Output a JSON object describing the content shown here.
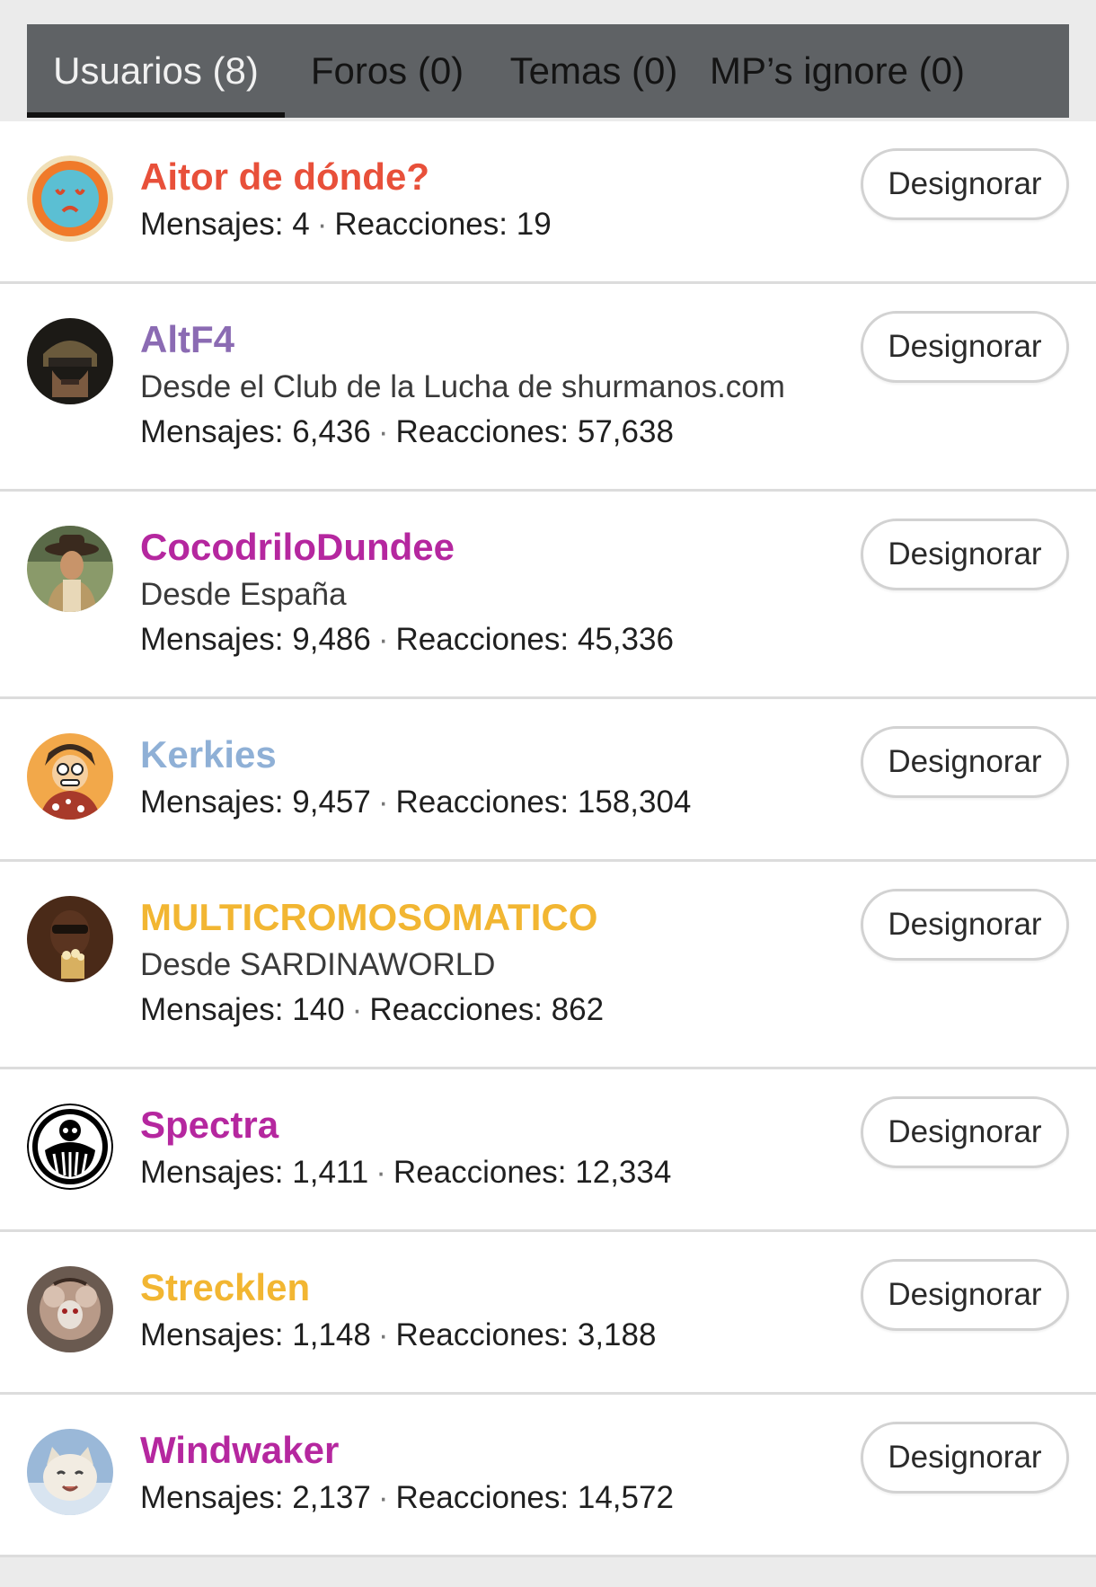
{
  "tabs": [
    {
      "label": "Usuarios (8)",
      "active": true
    },
    {
      "label": "Foros (0)",
      "active": false
    },
    {
      "label": "Temas (0)",
      "active": false
    },
    {
      "label": "MP’s ignore (0)",
      "active": false
    }
  ],
  "button_label": "Designorar",
  "stat_labels": {
    "messages": "Mensajes:",
    "reactions": "Reacciones:",
    "separator": "·"
  },
  "users": [
    {
      "name": "Aitor de dónde?",
      "name_color": "#e8503a",
      "location": "",
      "messages": "4",
      "reactions": "19",
      "avatar": "sad-face-avatar"
    },
    {
      "name": "AltF4",
      "name_color": "#8b6bb3",
      "location": "Desde el Club de la Lucha de shurmanos.com",
      "messages": "6,436",
      "reactions": "57,638",
      "avatar": "helmet-avatar"
    },
    {
      "name": "CocodriloDundee",
      "name_color": "#b5279f",
      "location": "Desde España",
      "messages": "9,486",
      "reactions": "45,336",
      "avatar": "hat-man-avatar"
    },
    {
      "name": "Kerkies",
      "name_color": "#8fb0d6",
      "location": "",
      "messages": "9,457",
      "reactions": "158,304",
      "avatar": "cartoon-avatar"
    },
    {
      "name": "MULTICROMOSOMATICO",
      "name_color": "#f2b632",
      "location": "Desde SARDINAWORLD",
      "messages": "140",
      "reactions": "862",
      "avatar": "popcorn-avatar"
    },
    {
      "name": "Spectra",
      "name_color": "#b5279f",
      "location": "",
      "messages": "1,411",
      "reactions": "12,334",
      "avatar": "octopus-logo-avatar"
    },
    {
      "name": "Strecklen",
      "name_color": "#f2b632",
      "location": "",
      "messages": "1,148",
      "reactions": "3,188",
      "avatar": "mouse-avatar"
    },
    {
      "name": "Windwaker",
      "name_color": "#b5279f",
      "location": "",
      "messages": "2,137",
      "reactions": "14,572",
      "avatar": "cat-avatar"
    }
  ]
}
